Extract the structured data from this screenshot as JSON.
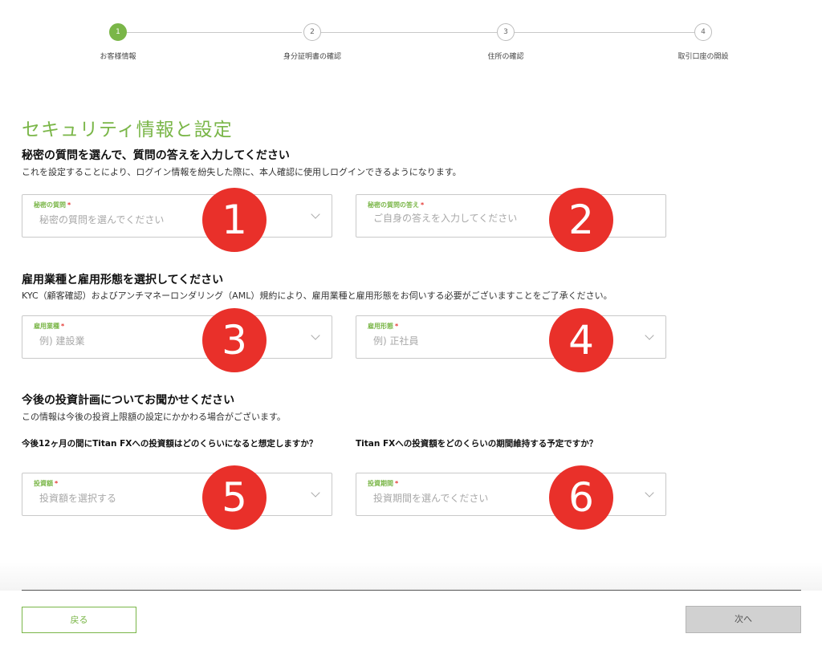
{
  "stepper": {
    "steps": [
      {
        "number": "1",
        "label": "お客様情報"
      },
      {
        "number": "2",
        "label": "身分証明書の確認"
      },
      {
        "number": "3",
        "label": "住所の確認"
      },
      {
        "number": "4",
        "label": "取引口座の開設"
      }
    ]
  },
  "page_title": "セキュリティ情報と設定",
  "sections": {
    "security": {
      "heading": "秘密の質問を選んで、質問の答えを入力してください",
      "description": "これを設定することにより、ログイン情報を紛失した際に、本人確認に使用しログインできるようになります。",
      "question_field": {
        "label": "秘密の質問",
        "required": "*",
        "placeholder": "秘密の質問を選んでください"
      },
      "answer_field": {
        "label": "秘密の質問の答え",
        "required": "*",
        "placeholder": "ご自身の答えを入力してください"
      }
    },
    "employment": {
      "heading": "雇用業種と雇用形態を選択してください",
      "description": "KYC（顧客確認）およびアンチマネーロンダリング（AML）規約により、雇用業種と雇用形態をお伺いする必要がございますことをご了承ください。",
      "industry_field": {
        "label": "雇用業種",
        "required": "*",
        "placeholder": "例) 建設業"
      },
      "type_field": {
        "label": "雇用形態",
        "required": "*",
        "placeholder": "例) 正社員"
      }
    },
    "investment": {
      "heading": "今後の投資計画についてお聞かせください",
      "description": "この情報は今後の投資上限額の設定にかかわる場合がございます。",
      "question_amount": "今後12ヶ月の間にTitan FXへの投資額はどのくらいになると想定しますか？",
      "question_period": "Titan FXへの投資額をどのくらいの期間維持する予定ですか？",
      "amount_field": {
        "label": "投資額",
        "required": "*",
        "placeholder": "投資額を選択する"
      },
      "period_field": {
        "label": "投資期間",
        "required": "*",
        "placeholder": "投資期間を選んでください"
      }
    }
  },
  "badges": [
    "1",
    "2",
    "3",
    "4",
    "5",
    "6"
  ],
  "footer": {
    "back_label": "戻る",
    "next_label": "次へ"
  },
  "colors": {
    "accent": "#7ab648",
    "badge": "#e9302a",
    "required": "#e53935"
  }
}
